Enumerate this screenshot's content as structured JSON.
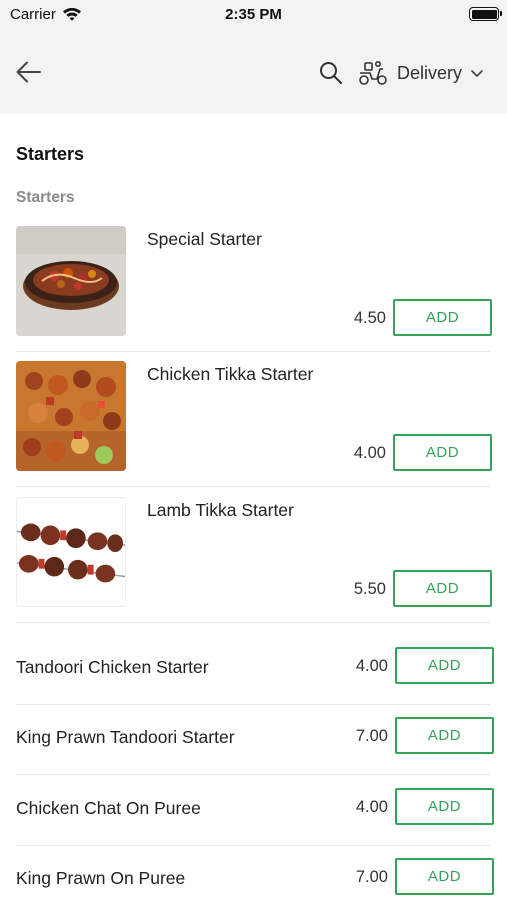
{
  "status_bar": {
    "carrier": "Carrier",
    "time": "2:35 PM",
    "wifi_icon": "wifi-icon",
    "battery_icon": "battery-icon"
  },
  "nav": {
    "back_icon": "arrow-left-icon",
    "search_icon": "search-icon",
    "delivery_icon": "scooter-icon",
    "delivery_label": "Delivery",
    "dropdown_icon": "chevron-down-icon"
  },
  "section": {
    "title": "Starters",
    "subtitle": "Starters"
  },
  "items": [
    {
      "name": "Special Starter",
      "price": "4.50",
      "add_label": "ADD",
      "image": "sizzling-platter"
    },
    {
      "name": "Chicken Tikka Starter",
      "price": "4.00",
      "add_label": "ADD",
      "image": "chicken-tikka-skewers"
    },
    {
      "name": "Lamb Tikka Starter",
      "price": "5.50",
      "add_label": "ADD",
      "image": "lamb-tikka-skewers"
    },
    {
      "name": "Tandoori Chicken Starter",
      "price": "4.00",
      "add_label": "ADD"
    },
    {
      "name": "King Prawn Tandoori Starter",
      "price": "7.00",
      "add_label": "ADD"
    },
    {
      "name": "Chicken Chat On Puree",
      "price": "4.00",
      "add_label": "ADD"
    },
    {
      "name": "King Prawn On Puree",
      "price": "7.00",
      "add_label": "ADD"
    }
  ],
  "colors": {
    "accent": "#35a35a",
    "header_bg": "#f3f3f3",
    "muted_text": "#8a8a8a"
  }
}
